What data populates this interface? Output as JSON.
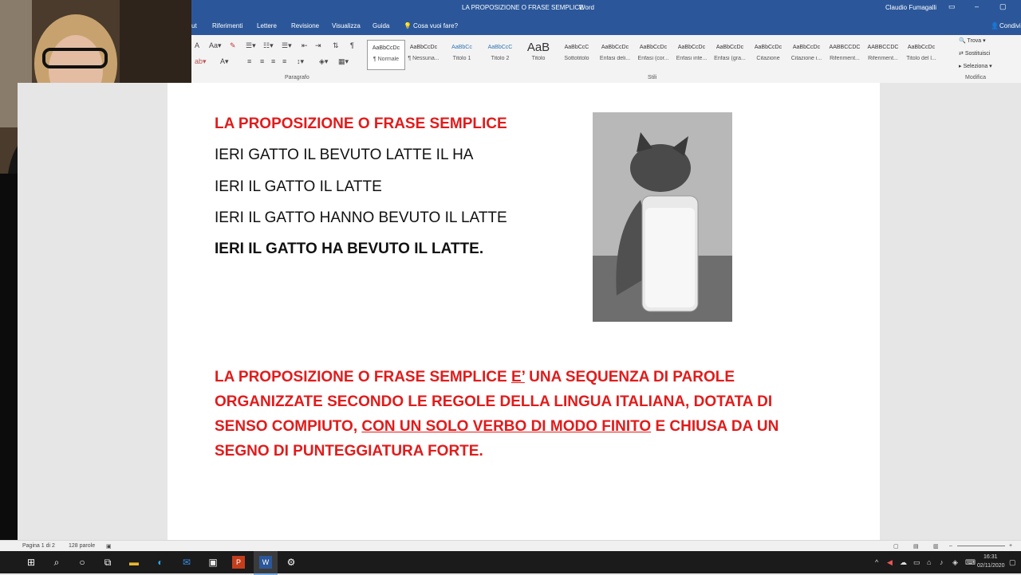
{
  "window": {
    "title": "LA PROPOSIZIONE O FRASE SEMPLICE",
    "app": "Word",
    "user": "Claudio Fumagalli",
    "share_label": "Condivi",
    "controls": {
      "ribbon_display": "▭",
      "minimize": "–",
      "maximize": "▢"
    }
  },
  "menu": {
    "items": [
      "ut",
      "Riferimenti",
      "Lettere",
      "Revisione",
      "Visualizza",
      "Guida"
    ],
    "tell_me": "Cosa vuoi fare?"
  },
  "ribbon": {
    "groups": {
      "paragraph": "Paragrafo",
      "styles": "Stili",
      "edit": "Modifica"
    },
    "styles": [
      {
        "preview": "AaBbCcDc",
        "name": "¶ Normale"
      },
      {
        "preview": "AaBbCcDc",
        "name": "¶ Nessuna..."
      },
      {
        "preview": "AaBbCc",
        "name": "Titolo 1"
      },
      {
        "preview": "AaBbCcC",
        "name": "Titolo 2"
      },
      {
        "preview": "AaB",
        "name": "Titolo"
      },
      {
        "preview": "AaBbCcC",
        "name": "Sottotitolo"
      },
      {
        "preview": "AaBbCcDc",
        "name": "Enfasi deli..."
      },
      {
        "preview": "AaBbCcDc",
        "name": "Enfasi (cor..."
      },
      {
        "preview": "AaBbCcDc",
        "name": "Enfasi inte..."
      },
      {
        "preview": "AaBbCcDc",
        "name": "Enfasi (gra..."
      },
      {
        "preview": "AaBbCcDc",
        "name": "Citazione"
      },
      {
        "preview": "AaBbCcDc",
        "name": "Citazione i..."
      },
      {
        "preview": "AABBCCDC",
        "name": "Riferiment..."
      },
      {
        "preview": "AABBCCDC",
        "name": "Riferiment..."
      },
      {
        "preview": "AaBbCcDc",
        "name": "Titolo del l..."
      }
    ],
    "find": "Trova",
    "replace": "Sostituisci",
    "select": "Seleziona"
  },
  "document": {
    "heading": "LA PROPOSIZIONE O FRASE SEMPLICE",
    "lines": [
      "IERI GATTO IL BEVUTO LATTE IL HA",
      "IERI IL GATTO IL LATTE",
      "IERI IL GATTO HANNO BEVUTO IL LATTE",
      "IERI IL GATTO HA BEVUTO IL LATTE."
    ],
    "definition": {
      "part1": "LA PROPOSIZIONE O FRASE SEMPLICE ",
      "part2": "E’",
      "part3": " UNA SEQUENZA DI PAROLE ORGANIZZATE SECONDO LE REGOLE DELLA LINGUA ITALIANA, DOTATA DI SENSO COMPIUTO, ",
      "part4": "CON UN SOLO VERBO DI MODO FINITO",
      "part5": " E CHIUSA DA UN SEGNO DI PUNTEGGIATURA FORTE."
    }
  },
  "status": {
    "page": "Pagina 1 di 2",
    "words": "128 parole"
  },
  "taskbar": {
    "time": "16:31",
    "date": "02/11/2020"
  },
  "colors": {
    "word_blue": "#2b579a",
    "doc_red": "#e21b1b"
  }
}
